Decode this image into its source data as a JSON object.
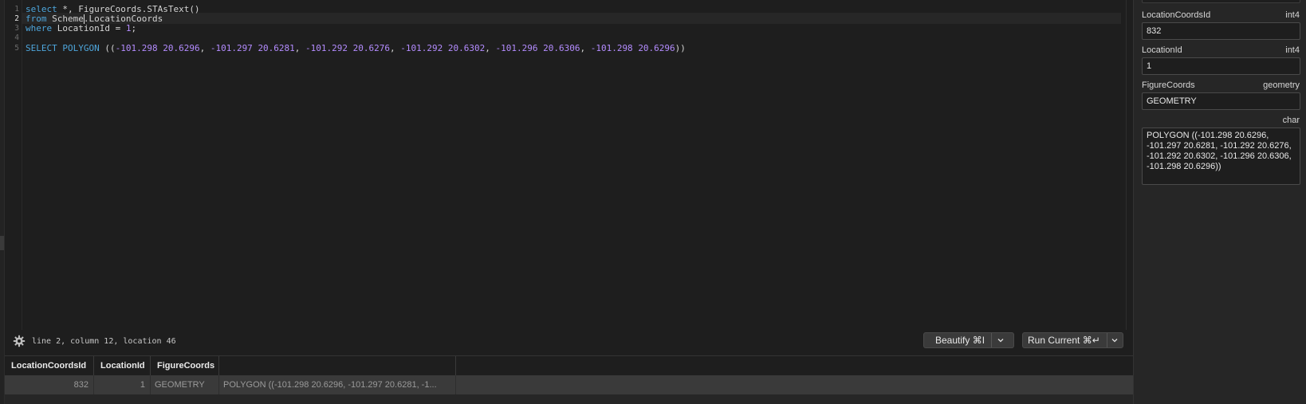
{
  "editor": {
    "line_numbers": [
      "1",
      "2",
      "3",
      "4",
      "5"
    ],
    "active_line": 2,
    "lines": [
      [
        {
          "t": "kw",
          "v": "select"
        },
        {
          "t": "txt",
          "v": " *, FigureCoords.STAsText()"
        }
      ],
      [
        {
          "t": "kw",
          "v": "from"
        },
        {
          "t": "txt",
          "v": " Scheme.LocationCoords"
        }
      ],
      [
        {
          "t": "kw",
          "v": "where"
        },
        {
          "t": "txt",
          "v": " LocationId = "
        },
        {
          "t": "num",
          "v": "1"
        },
        {
          "t": "txt",
          "v": ";"
        }
      ],
      [],
      [
        {
          "t": "kw",
          "v": "SELECT"
        },
        {
          "t": "txt",
          "v": " "
        },
        {
          "t": "kw",
          "v": "POLYGON"
        },
        {
          "t": "txt",
          "v": " (("
        },
        {
          "t": "num",
          "v": "-101.298"
        },
        {
          "t": "txt",
          "v": " "
        },
        {
          "t": "num",
          "v": "20.6296"
        },
        {
          "t": "txt",
          "v": ", "
        },
        {
          "t": "num",
          "v": "-101.297"
        },
        {
          "t": "txt",
          "v": " "
        },
        {
          "t": "num",
          "v": "20.6281"
        },
        {
          "t": "txt",
          "v": ", "
        },
        {
          "t": "num",
          "v": "-101.292"
        },
        {
          "t": "txt",
          "v": " "
        },
        {
          "t": "num",
          "v": "20.6276"
        },
        {
          "t": "txt",
          "v": ", "
        },
        {
          "t": "num",
          "v": "-101.292"
        },
        {
          "t": "txt",
          "v": " "
        },
        {
          "t": "num",
          "v": "20.6302"
        },
        {
          "t": "txt",
          "v": ", "
        },
        {
          "t": "num",
          "v": "-101.296"
        },
        {
          "t": "txt",
          "v": " "
        },
        {
          "t": "num",
          "v": "20.6306"
        },
        {
          "t": "txt",
          "v": ", "
        },
        {
          "t": "num",
          "v": "-101.298"
        },
        {
          "t": "txt",
          "v": " "
        },
        {
          "t": "num",
          "v": "20.6296"
        },
        {
          "t": "txt",
          "v": "))"
        }
      ]
    ]
  },
  "status": {
    "position_text": "line 2, column 12, location 46",
    "settings_icon": "gear-icon"
  },
  "toolbar": {
    "beautify_label": "Beautify ⌘I",
    "run_label": "Run Current ⌘↵",
    "dropdown_icon": "chevron-down-icon"
  },
  "results": {
    "columns": [
      "LocationCoordsId",
      "LocationId",
      "FigureCoords",
      ""
    ],
    "rows": [
      [
        "832",
        "1",
        "GEOMETRY",
        "POLYGON ((-101.298 20.6296, -101.297 20.6281, -1..."
      ]
    ]
  },
  "record_panel": {
    "fields": [
      {
        "label": "LocationCoordsId",
        "type": "int4",
        "value": "832"
      },
      {
        "label": "LocationId",
        "type": "int4",
        "value": "1"
      },
      {
        "label": "FigureCoords",
        "type": "geometry",
        "value": "GEOMETRY"
      },
      {
        "label": "",
        "type": "char",
        "value": "POLYGON ((-101.298 20.6296, -101.297 20.6281, -101.292 20.6276, -101.292 20.6302, -101.296 20.6306, -101.298 20.6296))"
      }
    ]
  },
  "colors": {
    "keyword": "#4ea6dc",
    "number": "#b48cff",
    "background": "#1e1e1e",
    "selected_row": "#3a3a3a"
  }
}
